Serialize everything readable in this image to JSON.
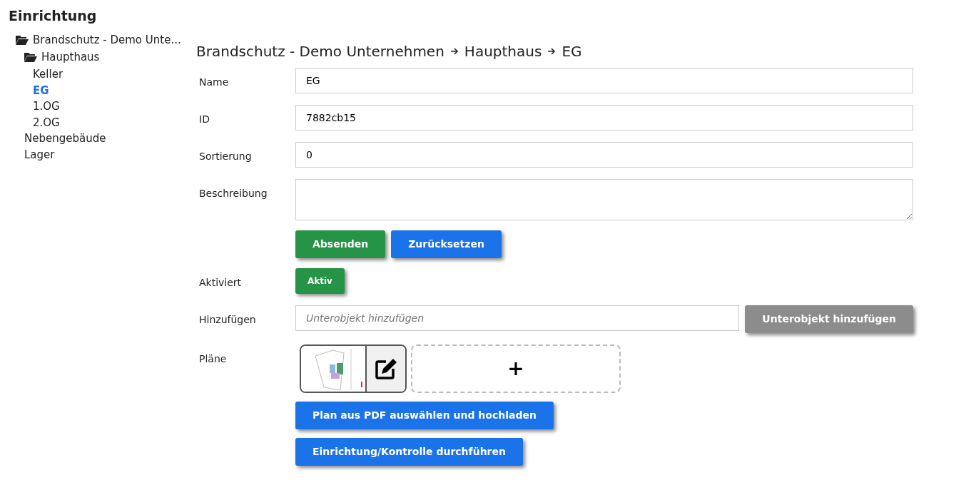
{
  "title": "Einrichtung",
  "tree": [
    {
      "label": "Brandschutz - Demo Unte...",
      "expanded": true,
      "selected": false,
      "children": [
        {
          "label": "Haupthaus",
          "expanded": true,
          "selected": false,
          "children": [
            {
              "label": "Keller",
              "selected": false
            },
            {
              "label": "EG",
              "selected": true
            },
            {
              "label": "1.OG",
              "selected": false
            },
            {
              "label": "2.OG",
              "selected": false
            }
          ]
        },
        {
          "label": "Nebengebäude",
          "expanded": false,
          "selected": false
        },
        {
          "label": "Lager",
          "expanded": false,
          "selected": false
        }
      ]
    }
  ],
  "breadcrumb": [
    "Brandschutz - Demo Unternehmen",
    "Haupthaus",
    "EG"
  ],
  "fields": [
    {
      "label": "Name",
      "kind": "input",
      "value": "EG"
    },
    {
      "label": "ID",
      "kind": "input",
      "value": "7882cb15"
    },
    {
      "label": "Sortierung",
      "kind": "input",
      "value": "0"
    },
    {
      "label": "Beschreibung",
      "kind": "textarea"
    }
  ],
  "form_buttons": [
    {
      "label": "Absenden",
      "kind": "success"
    },
    {
      "label": "Zurücksetzen",
      "kind": "primary"
    }
  ],
  "activated": {
    "label": "Aktiviert",
    "button": "Aktiv",
    "on": true
  },
  "add": {
    "label": "Hinzufügen",
    "placeholder": "Unterobjekt hinzufügen",
    "button": "Unterobjekt hinzufügen",
    "disabled": true
  },
  "plans": {
    "label": "Pläne",
    "add": "+"
  },
  "actions": [
    "Plan aus PDF auswählen und hochladen",
    "Einrichtung/Kontrolle durchführen"
  ]
}
